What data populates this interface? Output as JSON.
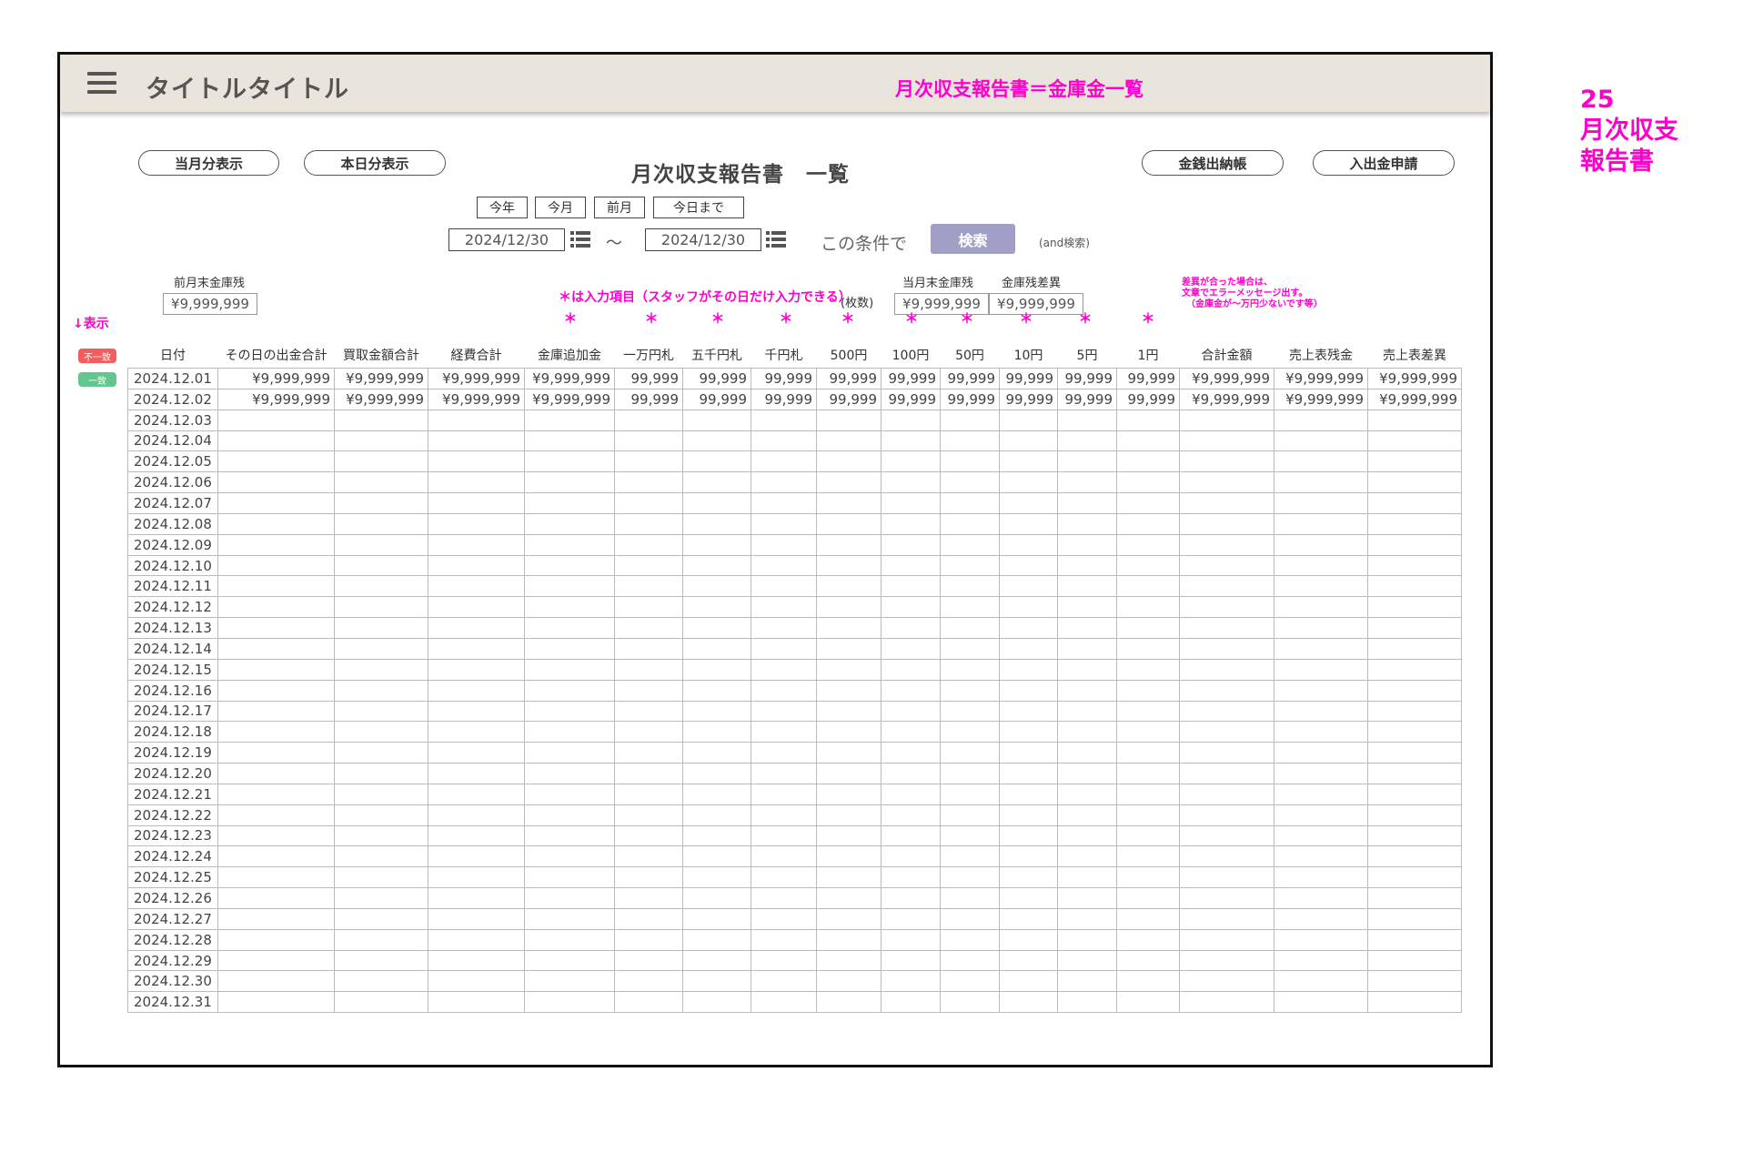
{
  "header": {
    "app_title": "タイトルタイトル",
    "screen_name": "月次収支報告書＝金庫金一覧"
  },
  "side_note": {
    "number": "25",
    "line1": "月次収支",
    "line2": "報告書"
  },
  "buttons": {
    "month_view": "当月分表示",
    "today_view": "本日分表示",
    "cash_ledger": "金銭出納帳",
    "deposit_request": "入出金申請"
  },
  "page_heading": "月次収支報告書　一覧",
  "filters": {
    "quick": [
      "今年",
      "今月",
      "前月",
      "今日まで"
    ],
    "date_from": "2024/12/30",
    "tilde": "～",
    "date_to": "2024/12/30",
    "condition_label": "この条件で",
    "search_label": "検索",
    "and_label": "(and検索)"
  },
  "summary": {
    "prev_month_label": "前月末金庫残",
    "prev_month_value": "¥9,999,999",
    "curr_month_label": "当月末金庫残",
    "curr_month_value": "¥9,999,999",
    "diff_label": "金庫残差異",
    "diff_value": "¥9,999,999"
  },
  "notes": {
    "input_items": "＊は入力項目（スタッフがその日だけ入力できる）",
    "count_unit": "(枚数)",
    "diff_error": "差異が合った場合は、\n文章でエラーメッセージ出す。\n　（金庫金が～万円少ないです等）",
    "show_label": "↓表示",
    "badge_mismatch": "不一致",
    "badge_match": "一致",
    "asterisk": "＊"
  },
  "table": {
    "columns": [
      "日付",
      "その日の出金合計",
      "買取金額合計",
      "経費合計",
      "金庫追加金",
      "一万円札",
      "五千円札",
      "千円札",
      "500円",
      "100円",
      "50円",
      "10円",
      "5円",
      "1円",
      "合計金額",
      "売上表残金",
      "売上表差異"
    ],
    "rows": [
      [
        "2024.12.01",
        "¥9,999,999",
        "¥9,999,999",
        "¥9,999,999",
        "¥9,999,999",
        "99,999",
        "99,999",
        "99,999",
        "99,999",
        "99,999",
        "99,999",
        "99,999",
        "99,999",
        "99,999",
        "¥9,999,999",
        "¥9,999,999",
        "¥9,999,999"
      ],
      [
        "2024.12.02",
        "¥9,999,999",
        "¥9,999,999",
        "¥9,999,999",
        "¥9,999,999",
        "99,999",
        "99,999",
        "99,999",
        "99,999",
        "99,999",
        "99,999",
        "99,999",
        "99,999",
        "99,999",
        "¥9,999,999",
        "¥9,999,999",
        "¥9,999,999"
      ],
      [
        "2024.12.03"
      ],
      [
        "2024.12.04"
      ],
      [
        "2024.12.05"
      ],
      [
        "2024.12.06"
      ],
      [
        "2024.12.07"
      ],
      [
        "2024.12.08"
      ],
      [
        "2024.12.09"
      ],
      [
        "2024.12.10"
      ],
      [
        "2024.12.11"
      ],
      [
        "2024.12.12"
      ],
      [
        "2024.12.13"
      ],
      [
        "2024.12.14"
      ],
      [
        "2024.12.15"
      ],
      [
        "2024.12.16"
      ],
      [
        "2024.12.17"
      ],
      [
        "2024.12.18"
      ],
      [
        "2024.12.19"
      ],
      [
        "2024.12.20"
      ],
      [
        "2024.12.21"
      ],
      [
        "2024.12.22"
      ],
      [
        "2024.12.23"
      ],
      [
        "2024.12.24"
      ],
      [
        "2024.12.25"
      ],
      [
        "2024.12.26"
      ],
      [
        "2024.12.27"
      ],
      [
        "2024.12.28"
      ],
      [
        "2024.12.29"
      ],
      [
        "2024.12.30"
      ],
      [
        "2024.12.31"
      ]
    ]
  },
  "colors": {
    "accent": "#ff00cc",
    "header_bg": "#e9e4dc",
    "search_button": "#a19fc6",
    "badge_mismatch": "#f35d5d",
    "badge_match": "#63c68d"
  },
  "icons": {
    "menu": "hamburger-menu-icon",
    "calendar_list": "list-icon"
  }
}
